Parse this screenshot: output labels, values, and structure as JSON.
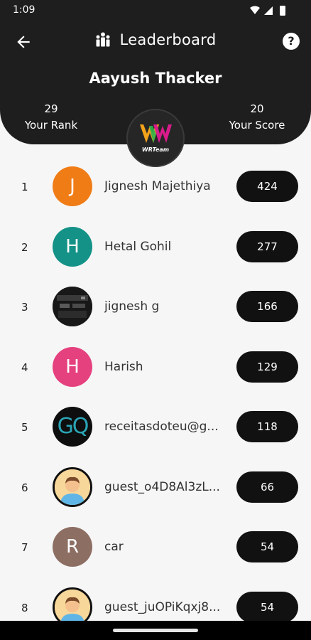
{
  "status_bar": {
    "time": "1:09"
  },
  "header": {
    "title": "Leaderboard",
    "user_name": "Aayush Thacker",
    "rank_value": "29",
    "rank_label": "Your Rank",
    "score_value": "20",
    "score_label": "Your Score",
    "logo_text": "WRTeam"
  },
  "leaderboard": [
    {
      "rank": "1",
      "name": "Jignesh Majethiya",
      "score": "424",
      "avatar_letter": "J",
      "avatar_color": "#f07c16",
      "avatar_type": "letter"
    },
    {
      "rank": "2",
      "name": "Hetal Gohil",
      "score": "277",
      "avatar_letter": "H",
      "avatar_color": "#149287",
      "avatar_type": "letter"
    },
    {
      "rank": "3",
      "name": "jignesh g",
      "score": "166",
      "avatar_letter": "",
      "avatar_color": "#111111",
      "avatar_type": "photo"
    },
    {
      "rank": "4",
      "name": "Harish",
      "score": "129",
      "avatar_letter": "H",
      "avatar_color": "#e5417f",
      "avatar_type": "letter"
    },
    {
      "rank": "5",
      "name": "receitasdoteu@g...",
      "score": "118",
      "avatar_letter": "GQ",
      "avatar_color": "#0e0e0e",
      "avatar_type": "gq"
    },
    {
      "rank": "6",
      "name": "guest_o4D8Al3zL...",
      "score": "66",
      "avatar_letter": "",
      "avatar_color": "#f7d79a",
      "avatar_type": "guest"
    },
    {
      "rank": "7",
      "name": "car",
      "score": "54",
      "avatar_letter": "R",
      "avatar_color": "#8d6e63",
      "avatar_type": "letter"
    },
    {
      "rank": "8",
      "name": "guest_juOPiKqxj8...",
      "score": "54",
      "avatar_letter": "",
      "avatar_color": "#f7d79a",
      "avatar_type": "guest"
    }
  ]
}
